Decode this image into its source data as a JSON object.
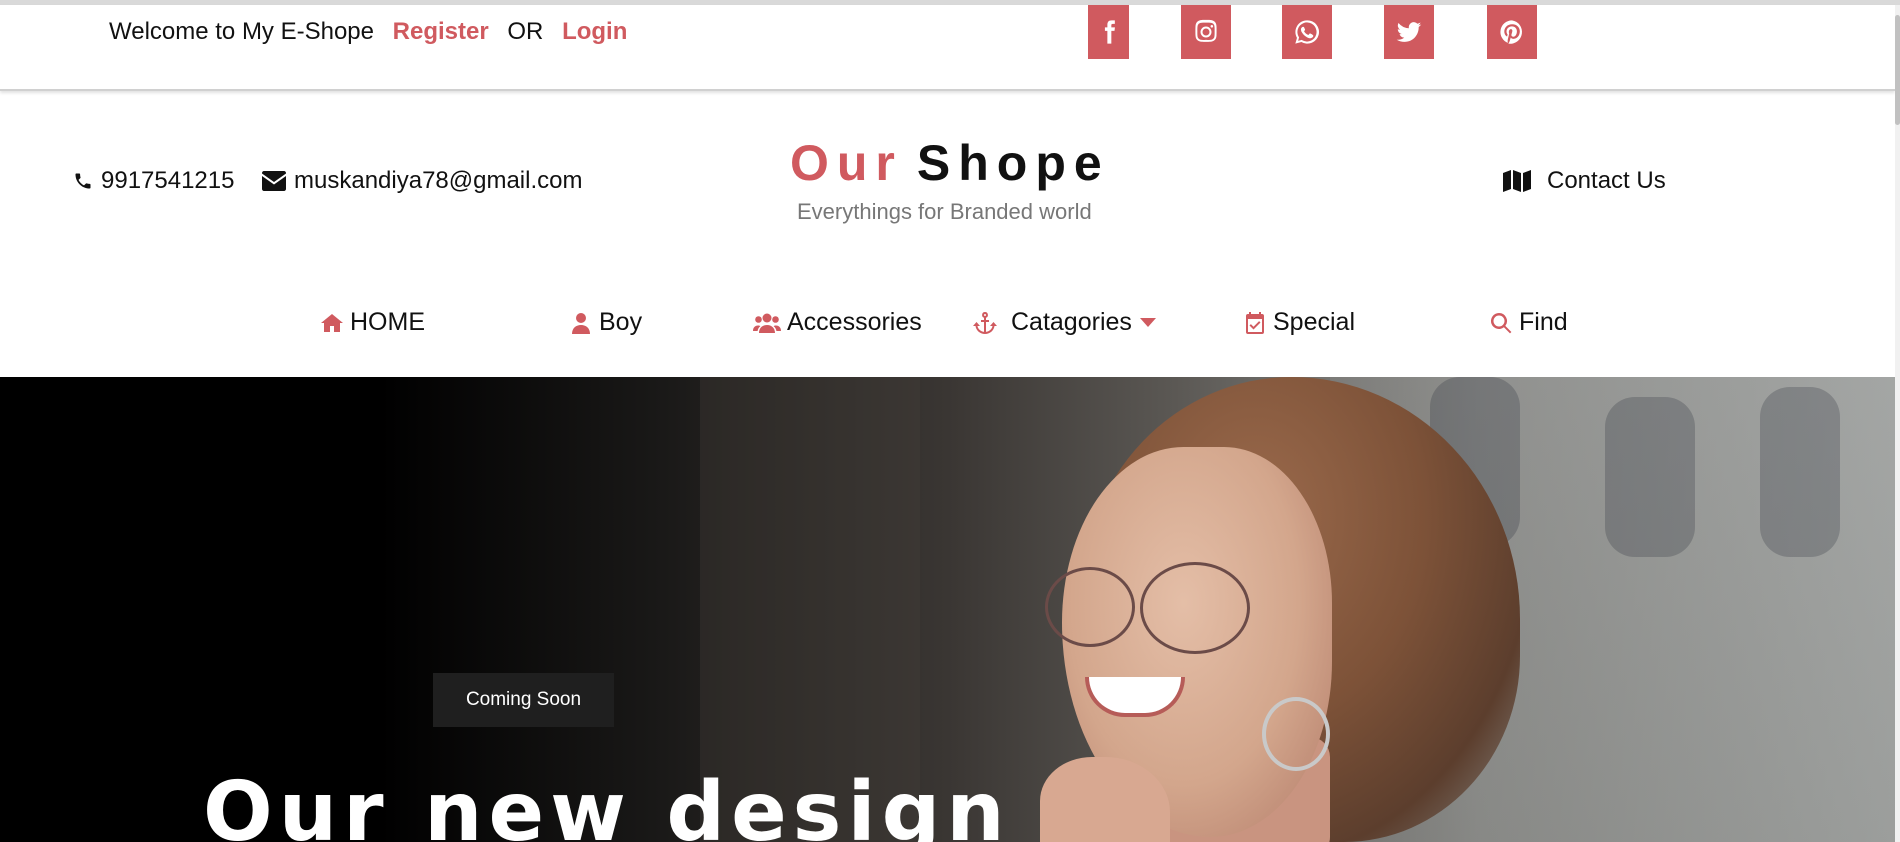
{
  "topbar": {
    "welcome": "Welcome to My E-Shope",
    "register": "Register",
    "or": "OR",
    "login": "Login",
    "social": [
      "facebook-icon",
      "instagram-icon",
      "whatsapp-icon",
      "twitter-icon",
      "pinterest-icon"
    ]
  },
  "header": {
    "phone": "9917541215",
    "email": "muskandiya78@gmail.com",
    "brand_part1": "Our",
    "brand_part2": "Shope",
    "tagline": "Everythings for Branded world",
    "contact": "Contact Us"
  },
  "nav": {
    "items": [
      {
        "label": "HOME",
        "icon": "home-icon"
      },
      {
        "label": "Boy",
        "icon": "user-icon"
      },
      {
        "label": "Accessories",
        "icon": "users-icon"
      },
      {
        "label": "Catagories",
        "icon": "anchor-icon"
      },
      {
        "label": "Special",
        "icon": "calendar-check-icon"
      },
      {
        "label": "Find",
        "icon": "search-icon"
      }
    ]
  },
  "hero": {
    "badge": "Coming Soon",
    "headline": "Our new design"
  },
  "colors": {
    "accent": "#d05a5f",
    "text": "#111111",
    "muted": "#777777"
  }
}
